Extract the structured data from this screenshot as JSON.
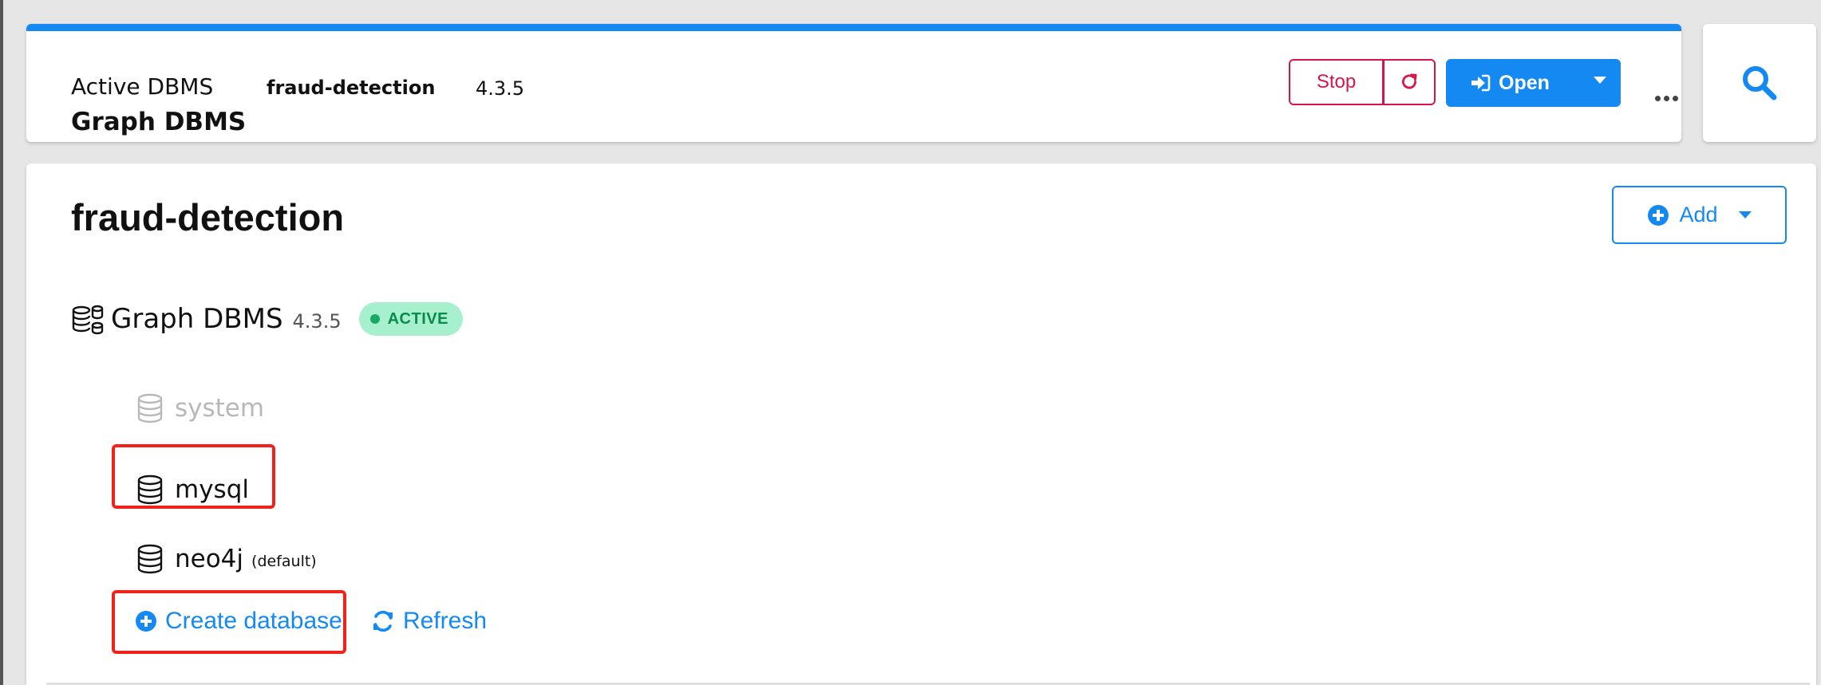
{
  "header": {
    "active_label": "Active DBMS",
    "project_name": "fraud-detection",
    "version": "4.3.5",
    "title": "Graph DBMS",
    "stop_label": "Stop",
    "open_label": "Open",
    "accent_color": "#1589f2",
    "danger_color": "#d6164b"
  },
  "main": {
    "title": "fraud-detection",
    "add_label": "Add",
    "dbms": {
      "name": "Graph DBMS",
      "version": "4.3.5",
      "status": "ACTIVE"
    },
    "databases": [
      {
        "name": "system",
        "note": "",
        "enabled": false
      },
      {
        "name": "mysql",
        "note": "",
        "enabled": true
      },
      {
        "name": "neo4j",
        "note": "(default)",
        "enabled": true
      }
    ],
    "create_label": "Create database",
    "refresh_label": "Refresh",
    "highlight_color": "#f0221a"
  }
}
